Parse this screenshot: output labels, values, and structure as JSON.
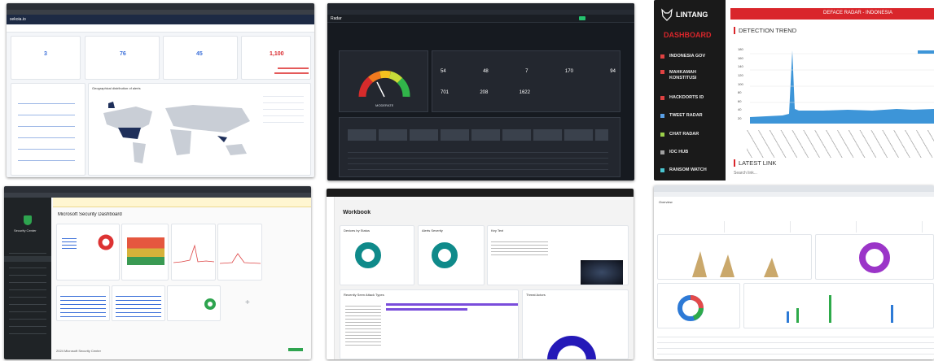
{
  "montage": {
    "tile1": {
      "app": "sekoia.io",
      "card1_value": "3",
      "card2_value": "76",
      "card3_value": "45",
      "card4_value": "1,100",
      "map_title": "Geographical distribution of alerts"
    },
    "tile2": {
      "brand": "Radar",
      "gauge_label": "MODERATE",
      "stats": [
        "54",
        "48",
        "7",
        "170",
        "94"
      ],
      "stats2": [
        "701",
        "208",
        "1622"
      ]
    },
    "tile3": {
      "logo_text": "LINTANG",
      "sidebar_title": "DASHBOARD",
      "banner": "DEFACE RADAR - INDONESIA",
      "section_title": "DETECTION TREND",
      "latest_title": "LATEST LINK",
      "search_placeholder": "Search link...",
      "menu": [
        {
          "label": "INDONESIA GOV",
          "color": "#e04242"
        },
        {
          "label": "MAHKAMAH KONSTITUSI",
          "color": "#e04242"
        },
        {
          "label": "HACKDORTS ID",
          "color": "#e04242"
        },
        {
          "label": "TWEET RADAR",
          "color": "#5aa0e6"
        },
        {
          "label": "CHAT RADAR",
          "color": "#9bd04a"
        },
        {
          "label": "IOC HUB",
          "color": "#a0a0a0"
        },
        {
          "label": "RANSOM WATCH",
          "color": "#4ac6d0"
        }
      ],
      "y_ticks": [
        "180",
        "160",
        "140",
        "120",
        "100",
        "80",
        "60",
        "40",
        "20"
      ]
    },
    "tile4": {
      "sidebar_brand": "Security Center",
      "title": "Microsoft Security Dashboard",
      "footer": "2024 Microsoft Security Center"
    },
    "tile5": {
      "title": "Workbook",
      "card1": "Devices by Status",
      "card2": "Alerts Severity",
      "card3": "Key Text",
      "card4": "Recently Seen Attack Types",
      "card5": "Threat Actors"
    },
    "tile6": {
      "title": "Overview"
    }
  },
  "colors": {
    "accent_red": "#d9262b",
    "dark_panel": "#1c1f25",
    "teal": "#0f8a8a",
    "purple": "#7a4ddb",
    "navy": "#2419b8",
    "blue_area": "#3d95d8"
  }
}
